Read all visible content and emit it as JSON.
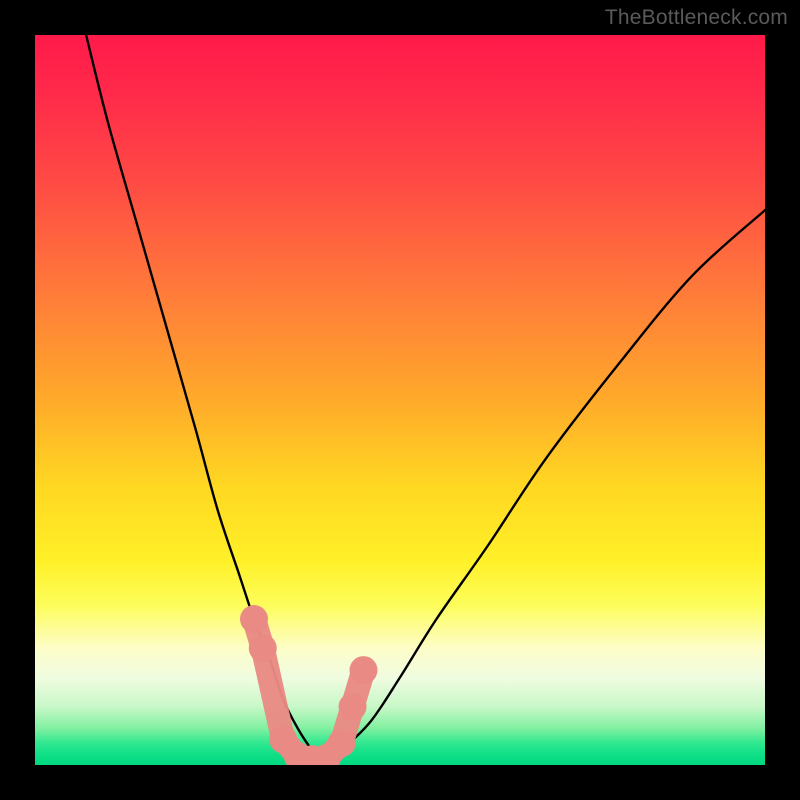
{
  "watermark": "TheBottleneck.com",
  "chart_data": {
    "type": "line",
    "title": "",
    "xlabel": "",
    "ylabel": "",
    "xlim": [
      0,
      100
    ],
    "ylim": [
      0,
      100
    ],
    "series": [
      {
        "name": "bottleneck-curve",
        "x": [
          7,
          10,
          14,
          18,
          22,
          25,
          28,
          30,
          32,
          34,
          36,
          38,
          40,
          42,
          46,
          50,
          55,
          62,
          70,
          80,
          90,
          100
        ],
        "y": [
          100,
          88,
          74,
          60,
          46,
          35,
          26,
          20,
          15,
          9,
          5,
          2,
          0,
          2,
          6,
          12,
          20,
          30,
          42,
          55,
          67,
          76
        ]
      }
    ],
    "markers": {
      "name": "highlight-points",
      "color": "#e98a84",
      "x": [
        30.0,
        31.2,
        34.0,
        36.0,
        38.0,
        40.0,
        42.0,
        43.5,
        45.0
      ],
      "y": [
        20,
        16,
        3.5,
        1.2,
        0.8,
        1.0,
        3.0,
        8,
        13
      ]
    },
    "background": {
      "type": "vertical-gradient",
      "description": "red (top) through orange/yellow to green (bottom)"
    }
  }
}
